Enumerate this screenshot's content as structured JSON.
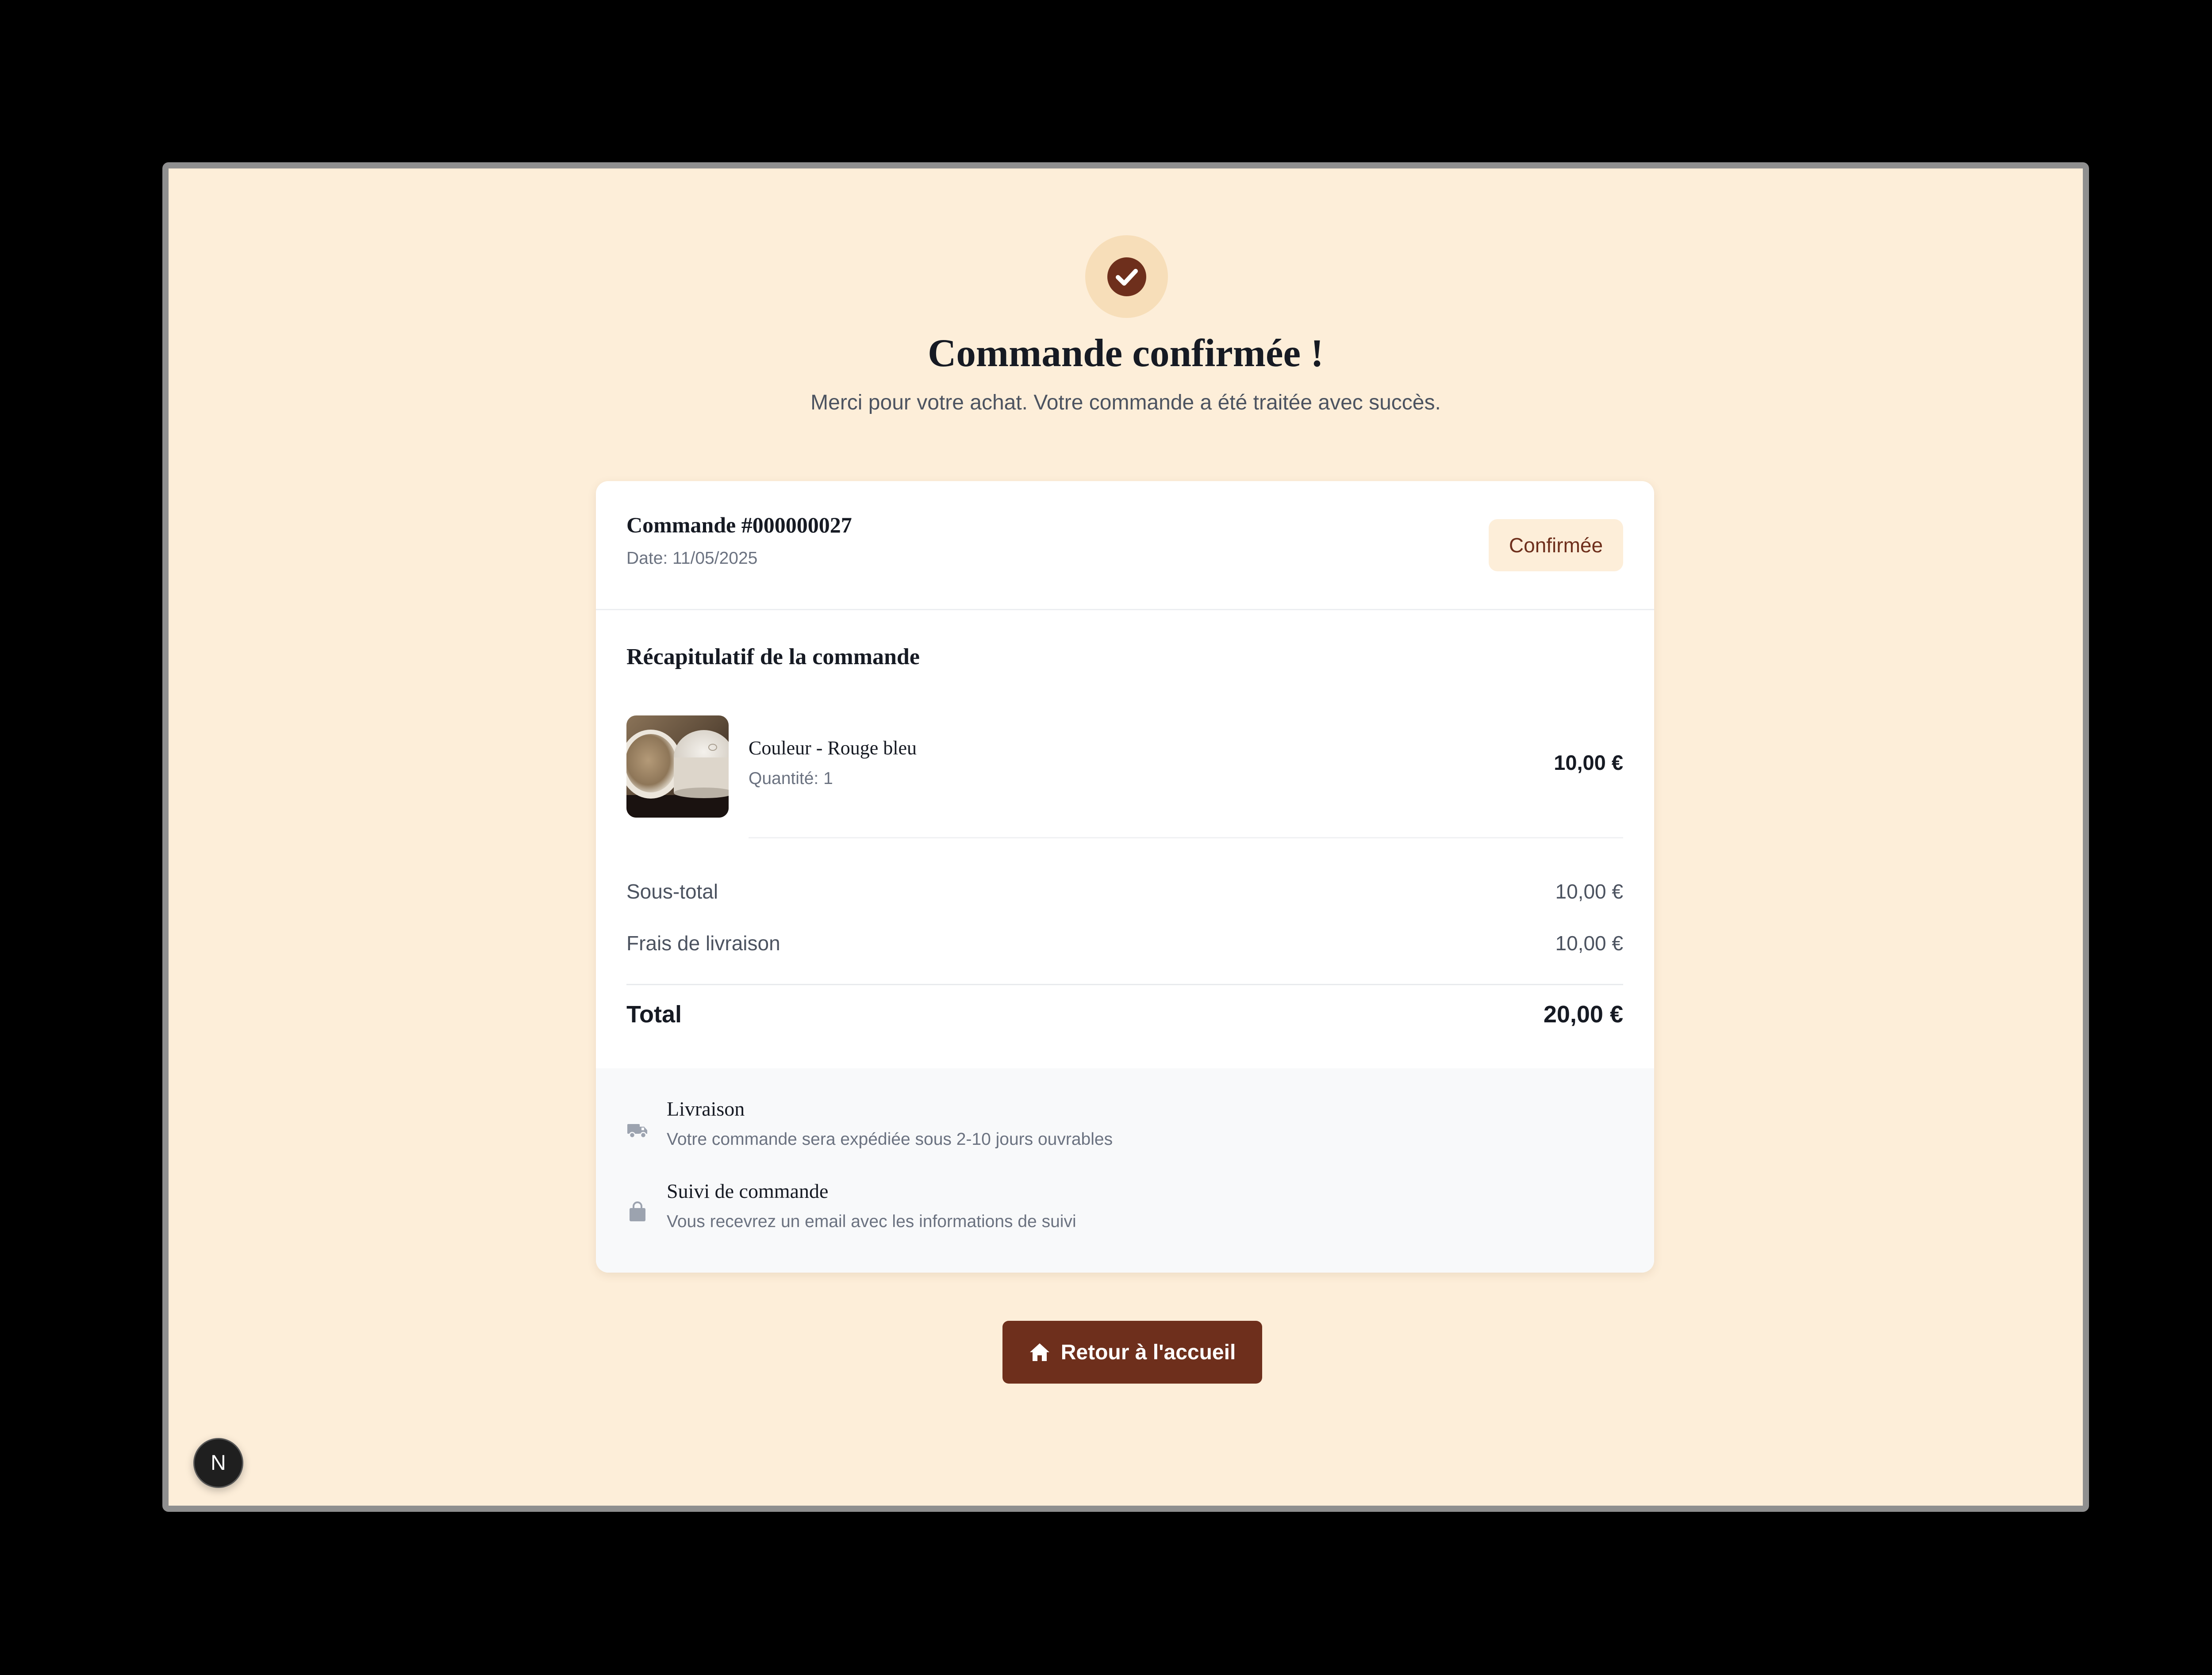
{
  "header": {
    "title": "Commande confirmée !",
    "subtitle": "Merci pour votre achat. Votre commande a été traitée avec succès."
  },
  "order": {
    "number_label": "Commande #000000027",
    "date_label": "Date: 11/05/2025",
    "status": "Confirmée"
  },
  "summary": {
    "title": "Récapitulatif de la commande",
    "items": [
      {
        "name": "Couleur - Rouge bleu",
        "quantity_label": "Quantité: 1",
        "price": "10,00 €"
      }
    ],
    "subtotal_label": "Sous-total",
    "subtotal_value": "10,00 €",
    "shipping_label": "Frais de livraison",
    "shipping_value": "10,00 €",
    "total_label": "Total",
    "total_value": "20,00 €"
  },
  "info": [
    {
      "icon": "truck-icon",
      "title": "Livraison",
      "text": "Votre commande sera expédiée sous 2-10 jours ouvrables"
    },
    {
      "icon": "shopping-bag-icon",
      "title": "Suivi de commande",
      "text": "Vous recevrez un email avec les informations de suivi"
    }
  ],
  "actions": {
    "home_label": "Retour à l'accueil"
  },
  "devtools": {
    "label": "N"
  },
  "colors": {
    "page_background": "#fdeed9",
    "accent": "#6e2f1c",
    "badge_background": "#f7deb9",
    "card_background": "#ffffff",
    "info_background": "#f8f9fa"
  }
}
